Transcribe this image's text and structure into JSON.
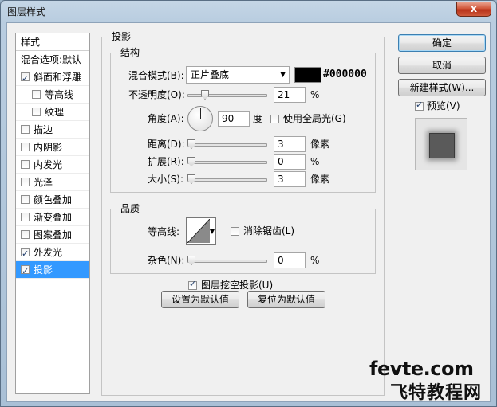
{
  "window": {
    "title": "图层样式",
    "close": "x"
  },
  "left": {
    "header": "样式",
    "blend": "混合选项:默认",
    "items": [
      {
        "label": "斜面和浮雕",
        "checked": true,
        "sub": false
      },
      {
        "label": "等高线",
        "checked": false,
        "sub": true
      },
      {
        "label": "纹理",
        "checked": false,
        "sub": true
      },
      {
        "label": "描边",
        "checked": false,
        "sub": false
      },
      {
        "label": "内阴影",
        "checked": false,
        "sub": false
      },
      {
        "label": "内发光",
        "checked": false,
        "sub": false
      },
      {
        "label": "光泽",
        "checked": false,
        "sub": false
      },
      {
        "label": "颜色叠加",
        "checked": false,
        "sub": false
      },
      {
        "label": "渐变叠加",
        "checked": false,
        "sub": false
      },
      {
        "label": "图案叠加",
        "checked": false,
        "sub": false
      },
      {
        "label": "外发光",
        "checked": true,
        "sub": false
      },
      {
        "label": "投影",
        "checked": true,
        "sub": false,
        "active": true
      }
    ]
  },
  "main": {
    "section_title": "投影",
    "structure": {
      "title": "结构",
      "blend_mode_label": "混合模式(B):",
      "blend_mode_value": "正片叠底",
      "color_hex": "#000000",
      "opacity_label": "不透明度(O):",
      "opacity_value": "21",
      "opacity_unit": "%",
      "angle_label": "角度(A):",
      "angle_value": "90",
      "angle_unit": "度",
      "global_light_label": "使用全局光(G)",
      "global_light_checked": false,
      "distance_label": "距离(D):",
      "distance_value": "3",
      "distance_unit": "像素",
      "spread_label": "扩展(R):",
      "spread_value": "0",
      "spread_unit": "%",
      "size_label": "大小(S):",
      "size_value": "3",
      "size_unit": "像素"
    },
    "quality": {
      "title": "品质",
      "contour_label": "等高线:",
      "anti_alias_label": "消除锯齿(L)",
      "anti_alias_checked": false,
      "noise_label": "杂色(N):",
      "noise_value": "0",
      "noise_unit": "%"
    },
    "knockout_label": "图层挖空投影(U)",
    "knockout_checked": true,
    "make_default": "设置为默认值",
    "reset_default": "复位为默认值"
  },
  "right": {
    "ok": "确定",
    "cancel": "取消",
    "new_style": "新建样式(W)...",
    "preview_label": "预览(V)",
    "preview_checked": true
  },
  "watermark": {
    "line1": "fevte.com",
    "line2": "飞特教程网"
  }
}
